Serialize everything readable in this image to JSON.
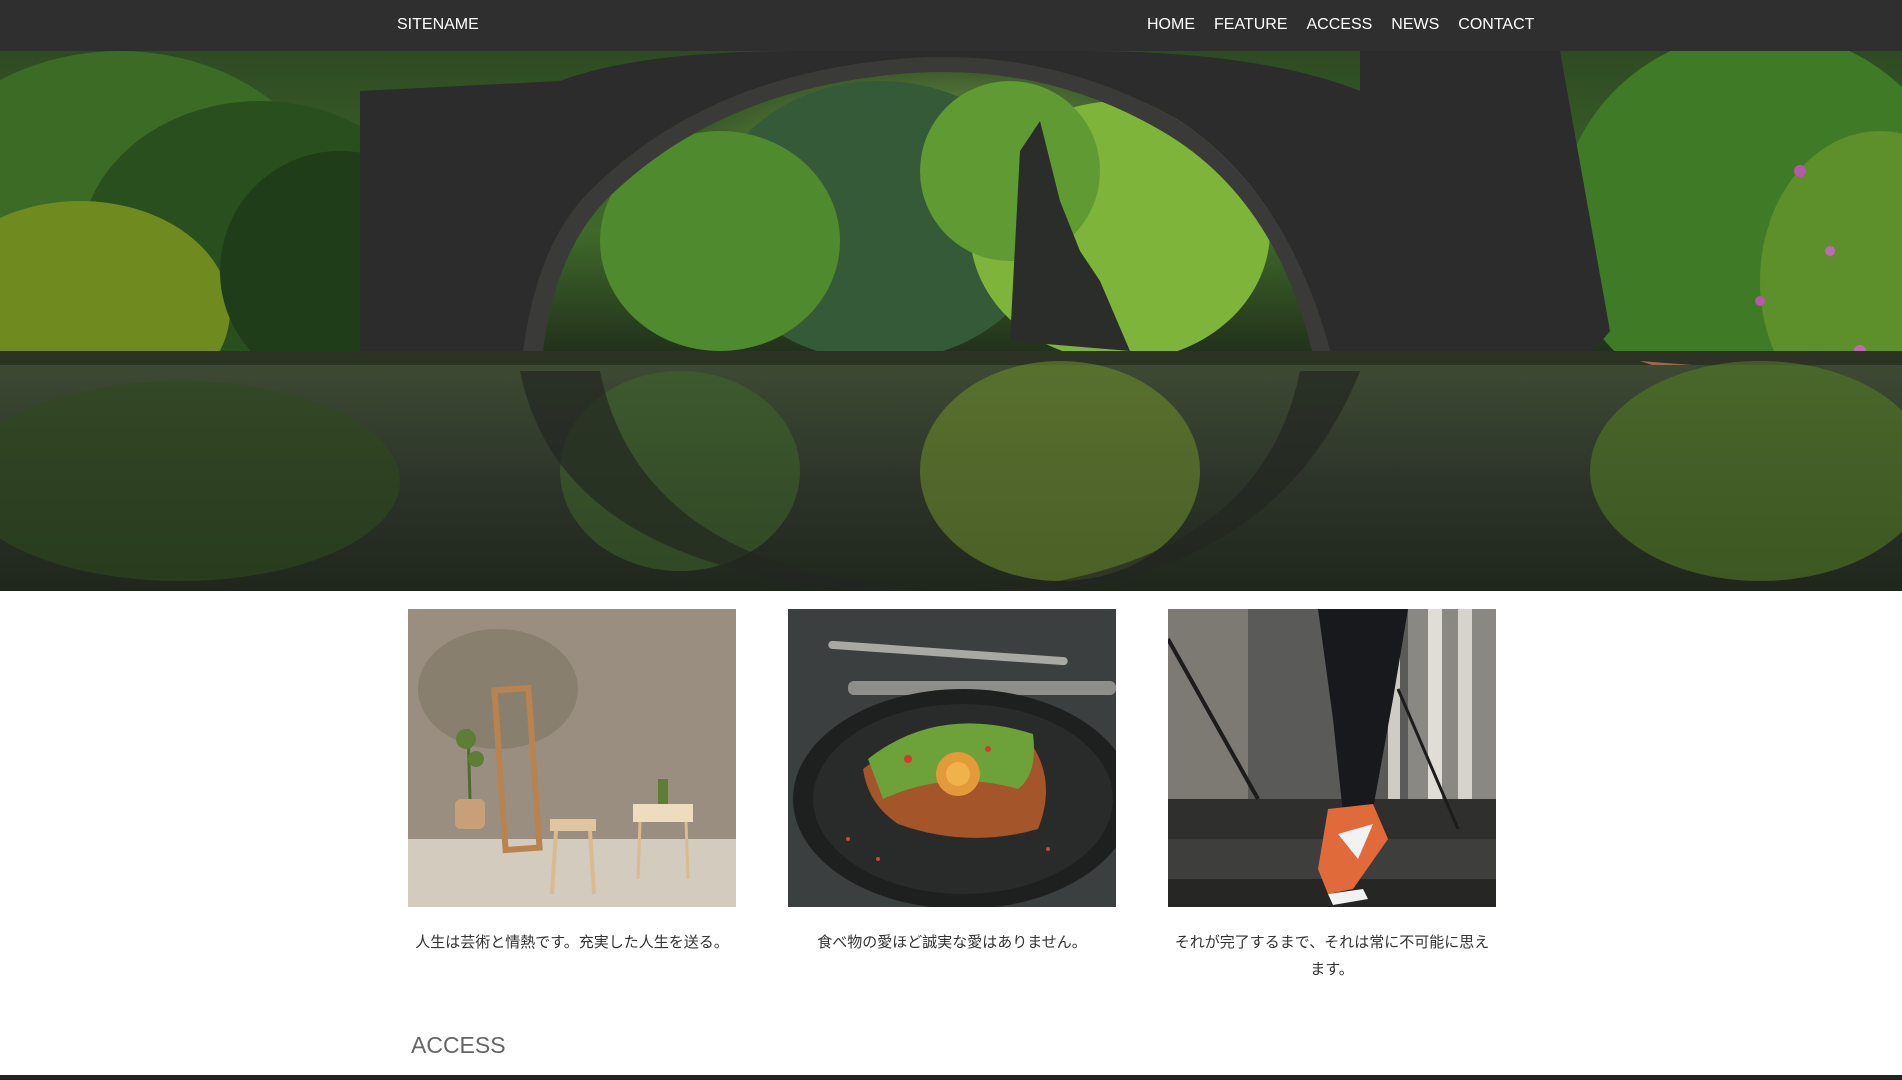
{
  "header": {
    "sitename": "SITENAME",
    "nav": [
      "HOME",
      "FEATURE",
      "ACCESS",
      "NEWS",
      "CONTACT"
    ]
  },
  "hero": {
    "image": "stone-arch-bridge-over-river-photo"
  },
  "features": [
    {
      "image": "interior-mirror-stool-plant-photo",
      "caption": "人生は芸術と情熱です。充実した人生を送る。"
    },
    {
      "image": "avocado-toast-on-dark-plate-photo",
      "caption": "食べ物の愛ほど誠実な愛はありません。"
    },
    {
      "image": "sneakers-walking-on-stairs-photo",
      "caption": "それが完了するまで、それは常に不可能に思えます。"
    }
  ],
  "sections": {
    "access_title": "ACCESS"
  },
  "colors": {
    "navbar": "#2f2f2f",
    "nav_text": "#ffffff",
    "caption_text": "#333333",
    "section_title": "#666666"
  }
}
